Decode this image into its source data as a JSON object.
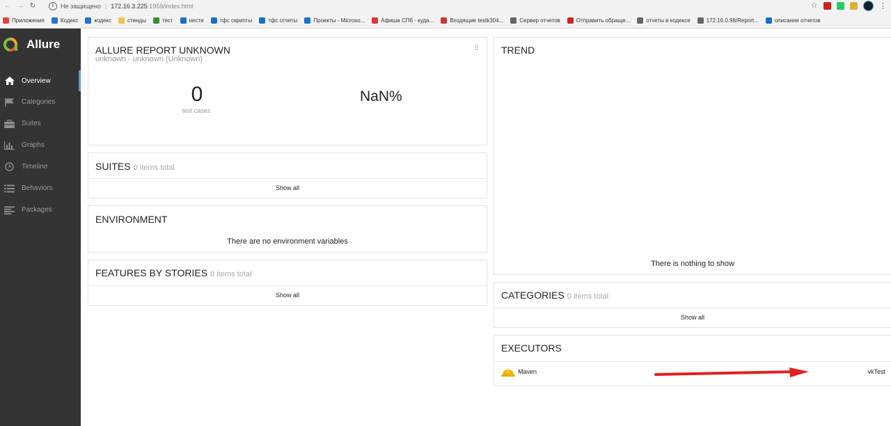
{
  "browser": {
    "insecure_label": "Не защищено",
    "url_host": "172.16.3.225",
    "url_path": ":1959/index.html",
    "bookmarks": [
      {
        "label": "Приложения",
        "color": "#d44"
      },
      {
        "label": "Кодекс",
        "color": "#2a6fc9"
      },
      {
        "label": "кодекс",
        "color": "#2a6fc9"
      },
      {
        "label": "стенды",
        "color": "#f0c14b"
      },
      {
        "label": "тест",
        "color": "#3a8a3a"
      },
      {
        "label": "нести",
        "color": "#1d70c8"
      },
      {
        "label": "тфс скрипты",
        "color": "#1d70c8"
      },
      {
        "label": "тфс отчеты",
        "color": "#1d70c8"
      },
      {
        "label": "Проекты - Microso...",
        "color": "#1d70c8"
      },
      {
        "label": "Афиша СПб - куда...",
        "color": "#d33"
      },
      {
        "label": "Входящие testk304...",
        "color": "#c33"
      },
      {
        "label": "Сервер отчетов",
        "color": "#666"
      },
      {
        "label": "Отправить обраще...",
        "color": "#c22"
      },
      {
        "label": "отчеты в кодексе",
        "color": "#666"
      },
      {
        "label": "172.16.0.98/Report...",
        "color": "#666"
      },
      {
        "label": "описание отчетов",
        "color": "#1d70c8"
      }
    ]
  },
  "sidebar": {
    "brand": "Allure",
    "items": [
      {
        "label": "Overview",
        "icon": "home-icon"
      },
      {
        "label": "Categories",
        "icon": "flag-icon"
      },
      {
        "label": "Suites",
        "icon": "briefcase-icon"
      },
      {
        "label": "Graphs",
        "icon": "bar-chart-icon"
      },
      {
        "label": "Timeline",
        "icon": "clock-icon"
      },
      {
        "label": "Behaviors",
        "icon": "list-icon"
      },
      {
        "label": "Packages",
        "icon": "align-left-icon"
      }
    ]
  },
  "summary": {
    "title": "ALLURE REPORT UNKNOWN",
    "subtitle": "unknown - unknown (Unknown)",
    "test_cases_count": "0",
    "test_cases_label": "test cases",
    "percent": "NaN%"
  },
  "suites": {
    "title": "SUITES",
    "count": "0 items total",
    "footer": "Show all"
  },
  "environment": {
    "title": "ENVIRONMENT",
    "message": "There are no environment variables"
  },
  "features": {
    "title": "FEATURES BY STORIES",
    "count": "0 items total",
    "footer": "Show all"
  },
  "trend": {
    "title": "TREND",
    "message": "There is nothing to show"
  },
  "categories": {
    "title": "CATEGORIES",
    "count": "0 items total",
    "footer": "Show all"
  },
  "executors": {
    "title": "EXECUTORS",
    "name": "Maven",
    "build": "vkTest"
  },
  "colors": {
    "sidebar_bg": "#343434",
    "active_bar": "#5e9cd1",
    "annotation_arrow": "#e02020"
  }
}
